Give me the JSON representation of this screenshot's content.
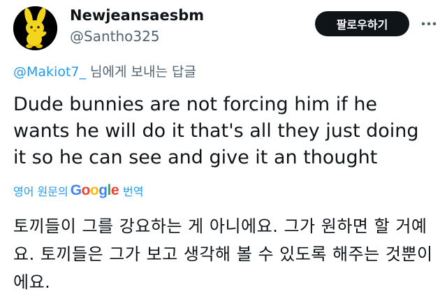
{
  "author": {
    "display_name": "Newjeansaesbm",
    "handle": "@Santho325"
  },
  "follow_button": {
    "label": "팔로우하기"
  },
  "reply_context": {
    "mention": "@Makiot7_",
    "suffix": " 님에게 보내는 답글"
  },
  "tweet": {
    "text": "Dude bunnies are not forcing him if he wants he will do it that's all they just doing it so he can see and give it an thought"
  },
  "translation": {
    "prefix": "영어 원문의",
    "provider": "Google",
    "suffix": "번역",
    "text": "토끼들이 그를 강요하는 게 아니에요. 그가 원하면 할 거예요. 토끼들은 그가 보고 생각해 볼 수 있도록 해주는 것뿐이에요."
  },
  "colors": {
    "link": "#1d9bf0",
    "secondary_text": "#536471",
    "button_bg": "#0f1419",
    "avatar_bunny": "#f3d51c"
  },
  "icons": {
    "avatar": "yellow-bunny-avatar",
    "more": "more-options-icon"
  }
}
